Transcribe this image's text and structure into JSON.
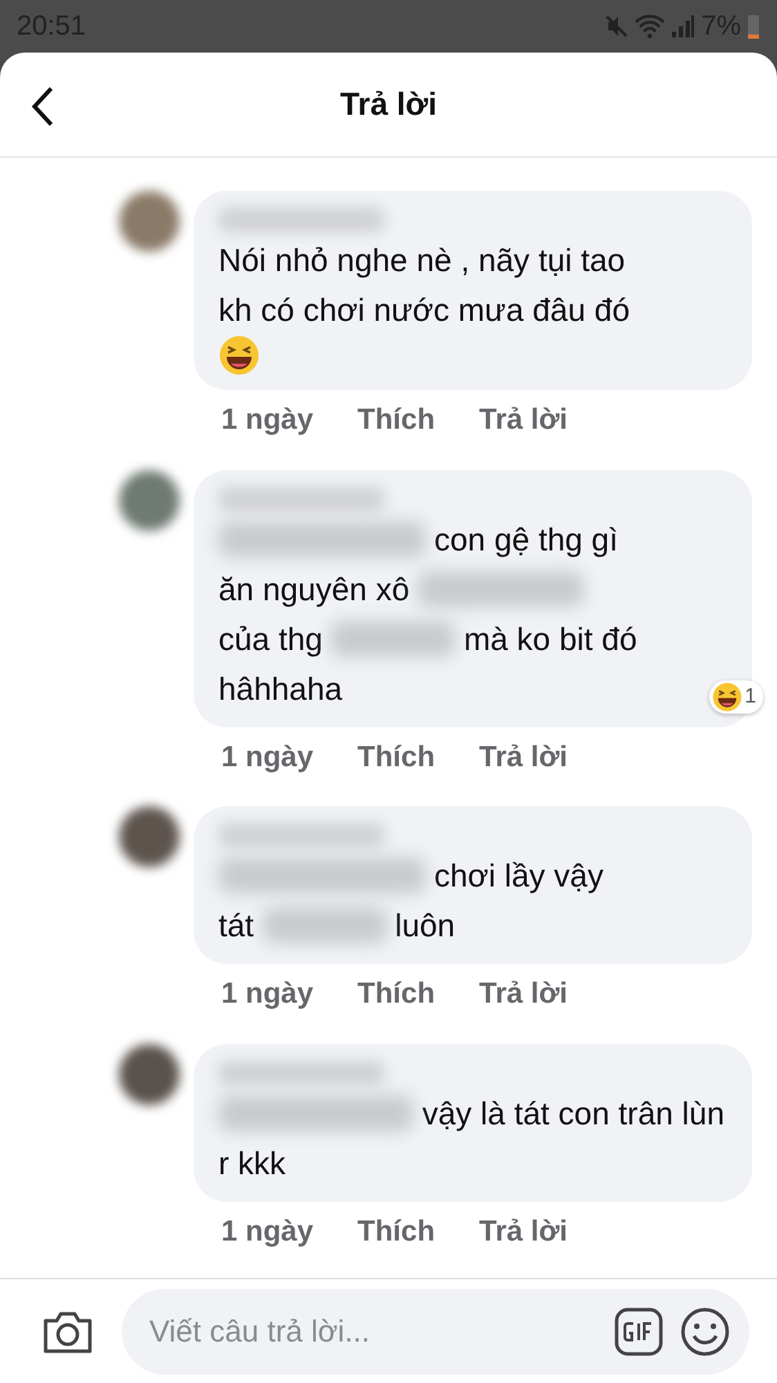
{
  "status_bar": {
    "time": "20:51",
    "battery": "7%"
  },
  "header": {
    "title": "Trả lời"
  },
  "comments": [
    {
      "lines": [
        [
          {
            "kind": "text",
            "text": "Nói nhỏ nghe nè , nãy tụi tao"
          }
        ],
        [
          {
            "kind": "text",
            "text": "kh có chơi nước mưa đâu đó"
          }
        ],
        [
          {
            "kind": "emoji"
          }
        ]
      ],
      "actions": [
        "1 ngày",
        "Thích",
        "Trả lời"
      ]
    },
    {
      "lines": [
        [
          {
            "kind": "blur"
          },
          {
            "kind": "text",
            "text": "con gệ thg gì"
          }
        ],
        [
          {
            "kind": "text",
            "text": "ăn nguyên xô"
          },
          {
            "kind": "blur"
          }
        ],
        [
          {
            "kind": "text",
            "text": "của thg"
          },
          {
            "kind": "blur"
          },
          {
            "kind": "text",
            "text": "mà ko bit đó"
          }
        ],
        [
          {
            "kind": "text",
            "text": "hâhhaha"
          }
        ]
      ],
      "reaction_count": "1",
      "actions": [
        "1 ngày",
        "Thích",
        "Trả lời"
      ]
    },
    {
      "lines": [
        [
          {
            "kind": "blur"
          },
          {
            "kind": "text",
            "text": "chơi lầy vậy"
          }
        ],
        [
          {
            "kind": "text",
            "text": "tát"
          },
          {
            "kind": "blur"
          },
          {
            "kind": "text",
            "text": "luôn"
          }
        ]
      ],
      "actions": [
        "1 ngày",
        "Thích",
        "Trả lời"
      ]
    },
    {
      "lines": [
        [
          {
            "kind": "blur"
          },
          {
            "kind": "text",
            "text": "vậy là tát con trân lùn"
          }
        ],
        [
          {
            "kind": "text",
            "text": "r kkk"
          }
        ]
      ],
      "actions": [
        "1 ngày",
        "Thích",
        "Trả lời"
      ]
    }
  ],
  "composer": {
    "placeholder": "Viết câu trả lời..."
  }
}
